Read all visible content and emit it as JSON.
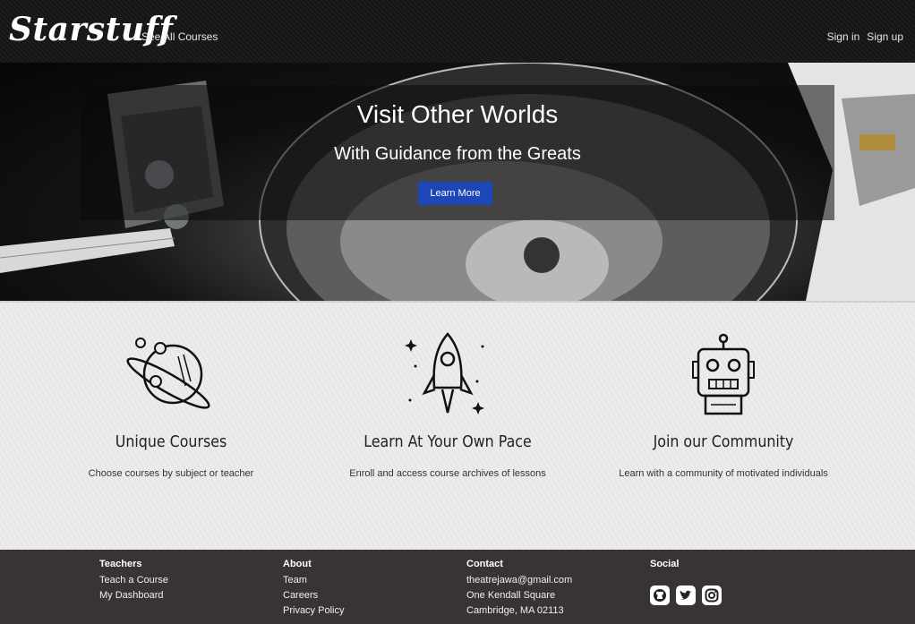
{
  "header": {
    "brand": "Starstuff",
    "see_all_courses": "See All Courses",
    "sign_in": "Sign in",
    "sign_up": "Sign up"
  },
  "hero": {
    "title": "Visit Other Worlds",
    "subtitle": "With Guidance from the Greats",
    "button": "Learn More",
    "button_color": "#1d46b8"
  },
  "features": [
    {
      "icon": "planet-icon",
      "title": "Unique Courses",
      "text": "Choose courses by subject or teacher"
    },
    {
      "icon": "rocket-icon",
      "title": "Learn At Your Own Pace",
      "text": "Enroll and access course archives of lessons"
    },
    {
      "icon": "robot-icon",
      "title": "Join our Community",
      "text": "Learn with a community of motivated individuals"
    }
  ],
  "footer": {
    "teachers": {
      "heading": "Teachers",
      "links": [
        "Teach a Course",
        "My Dashboard"
      ]
    },
    "about": {
      "heading": "About",
      "links": [
        "Team",
        "Careers",
        "Privacy Policy"
      ]
    },
    "contact": {
      "heading": "Contact",
      "lines": [
        "theatrejawa@gmail.com",
        "One Kendall Square",
        "Cambridge, MA 02113"
      ]
    },
    "social": {
      "heading": "Social",
      "icons": [
        "github-icon",
        "twitter-icon",
        "instagram-icon"
      ]
    }
  }
}
